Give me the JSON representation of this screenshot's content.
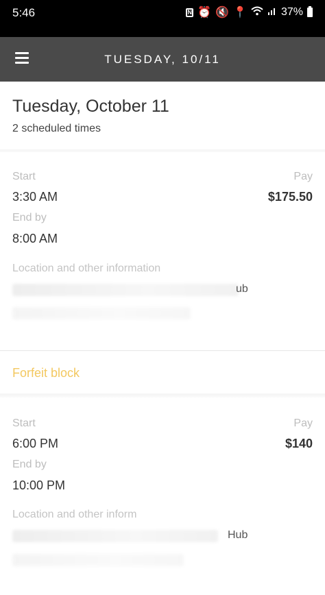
{
  "status_bar": {
    "time": "5:46",
    "battery": "37%",
    "icons": [
      "nfc-icon",
      "alarm-icon",
      "mute-icon",
      "location-icon",
      "wifi-icon",
      "signal-icon",
      "battery-icon"
    ]
  },
  "header": {
    "title": "TUESDAY, 10/11",
    "menu_icon": "hamburger-menu-icon"
  },
  "day": {
    "title": "Tuesday, October 11",
    "subtitle": "2 scheduled times"
  },
  "shifts": [
    {
      "start_label": "Start",
      "start_time": "3:30 AM",
      "end_label": "End by",
      "end_time": "8:00 AM",
      "pay_label": "Pay",
      "pay": "$175.50",
      "location_label": "Location and other information",
      "location_tail": "ub",
      "action": "Forfeit block"
    },
    {
      "start_label": "Start",
      "start_time": "6:00 PM",
      "end_label": "End by",
      "end_time": "10:00 PM",
      "pay_label": "Pay",
      "pay": "$140",
      "location_label": "Location and other inform",
      "location_tail": "Hub"
    }
  ],
  "colors": {
    "header_bg": "#4a4a4a",
    "status_bg": "#000000",
    "forfeit": "#f3c860"
  }
}
